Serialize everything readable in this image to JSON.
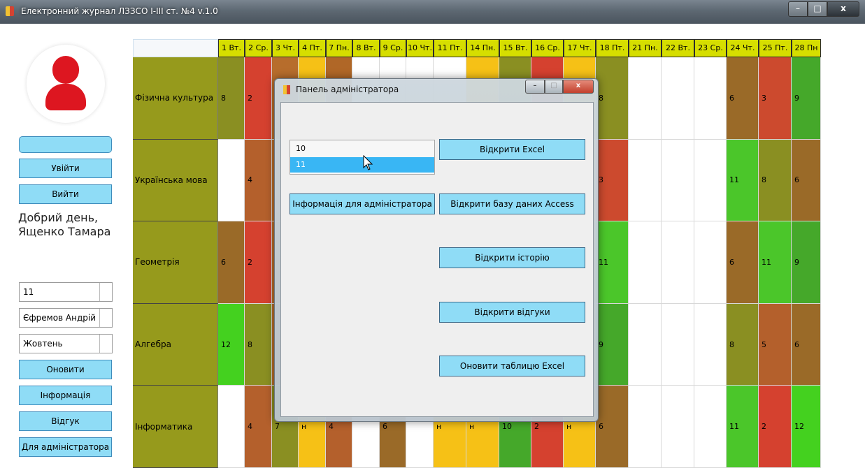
{
  "window": {
    "title": "Електронний журнал ЛЗЗСО І-ІІІ ст. №4 v.1.0",
    "controls": {
      "minimize": "–",
      "maximize": "□",
      "close": "x"
    }
  },
  "sidebar": {
    "name_field": "",
    "login_label": "Увійти",
    "logout_label": "Вийти",
    "greeting_line1": "Добрий день,",
    "greeting_line2": "Ященко Тамара",
    "class_value": "11",
    "student_value": "Єфремов Андрій",
    "month_value": "Жовтень",
    "refresh_label": "Оновити",
    "info_label": "Інформація",
    "feedback_label": "Відгук",
    "admin_label": "Для адміністратора"
  },
  "grid": {
    "dates": [
      "1 Вт.",
      "2 Ср.",
      "3 Чт.",
      "4 Пт.",
      "7 Пн.",
      "8 Вт.",
      "9 Ср.",
      "10 Чт.",
      "11 Пт.",
      "14 Пн.",
      "15 Вт.",
      "16 Ср.",
      "17 Чт.",
      "18 Пт.",
      "21 Пн.",
      "22 Вт.",
      "23 Ср.",
      "24 Чт.",
      "25 Пт.",
      "28 Пн"
    ],
    "rows": [
      {
        "subject": "Фізична культура",
        "cells": [
          {
            "v": "8",
            "c": "#8a8f22"
          },
          {
            "v": "2",
            "c": "#d5412f"
          },
          {
            "v": "",
            "c": "#b76d2c"
          },
          {
            "v": "",
            "c": "#f6c116"
          },
          {
            "v": "",
            "c": "#b06727"
          },
          {
            "v": "",
            "c": "#ffffff"
          },
          {
            "v": "",
            "c": "#ffffff"
          },
          {
            "v": "",
            "c": "#ffffff"
          },
          {
            "v": "",
            "c": "#ffffff"
          },
          {
            "v": "",
            "c": "#f6c116"
          },
          {
            "v": "",
            "c": "#8a8f22"
          },
          {
            "v": "",
            "c": "#d5412f"
          },
          {
            "v": "",
            "c": "#f6c116"
          },
          {
            "v": "8",
            "c": "#8a8f22"
          },
          {
            "v": "",
            "c": "#ffffff"
          },
          {
            "v": "",
            "c": "#ffffff"
          },
          {
            "v": "",
            "c": "#ffffff"
          },
          {
            "v": "6",
            "c": "#9a6a28"
          },
          {
            "v": "3",
            "c": "#cc4a2e"
          },
          {
            "v": "9",
            "c": "#45a82a"
          }
        ]
      },
      {
        "subject": "Українська мова",
        "cells": [
          {
            "v": "",
            "c": "#ffffff"
          },
          {
            "v": "4",
            "c": "#b4602c"
          },
          {
            "v": "",
            "c": "#b76d2c"
          },
          {
            "v": "",
            "c": "#f6c116"
          },
          {
            "v": "",
            "c": "#b06727"
          },
          {
            "v": "",
            "c": "#ffffff"
          },
          {
            "v": "",
            "c": "#ffffff"
          },
          {
            "v": "",
            "c": "#ffffff"
          },
          {
            "v": "",
            "c": "#ffffff"
          },
          {
            "v": "",
            "c": "#f6c116"
          },
          {
            "v": "",
            "c": "#8a8f22"
          },
          {
            "v": "",
            "c": "#d5412f"
          },
          {
            "v": "",
            "c": "#f6c116"
          },
          {
            "v": "3",
            "c": "#cc4a2e"
          },
          {
            "v": "",
            "c": "#ffffff"
          },
          {
            "v": "",
            "c": "#ffffff"
          },
          {
            "v": "",
            "c": "#ffffff"
          },
          {
            "v": "11",
            "c": "#4bc62a"
          },
          {
            "v": "8",
            "c": "#8a8f22"
          },
          {
            "v": "6",
            "c": "#9a6a28"
          }
        ]
      },
      {
        "subject": "Геометрія",
        "cells": [
          {
            "v": "6",
            "c": "#9a6a28"
          },
          {
            "v": "2",
            "c": "#d5412f"
          },
          {
            "v": "",
            "c": "#b76d2c"
          },
          {
            "v": "",
            "c": "#f6c116"
          },
          {
            "v": "",
            "c": "#b06727"
          },
          {
            "v": "",
            "c": "#ffffff"
          },
          {
            "v": "",
            "c": "#ffffff"
          },
          {
            "v": "",
            "c": "#ffffff"
          },
          {
            "v": "",
            "c": "#ffffff"
          },
          {
            "v": "",
            "c": "#f6c116"
          },
          {
            "v": "",
            "c": "#8a8f22"
          },
          {
            "v": "",
            "c": "#d5412f"
          },
          {
            "v": "",
            "c": "#f6c116"
          },
          {
            "v": "11",
            "c": "#4bc62a"
          },
          {
            "v": "",
            "c": "#ffffff"
          },
          {
            "v": "",
            "c": "#ffffff"
          },
          {
            "v": "",
            "c": "#ffffff"
          },
          {
            "v": "6",
            "c": "#9a6a28"
          },
          {
            "v": "11",
            "c": "#4bc62a"
          },
          {
            "v": "9",
            "c": "#45a82a"
          }
        ]
      },
      {
        "subject": "Алгебра",
        "cells": [
          {
            "v": "12",
            "c": "#44d11f"
          },
          {
            "v": "8",
            "c": "#8a8f22"
          },
          {
            "v": "",
            "c": "#b76d2c"
          },
          {
            "v": "",
            "c": "#f6c116"
          },
          {
            "v": "",
            "c": "#b06727"
          },
          {
            "v": "",
            "c": "#ffffff"
          },
          {
            "v": "",
            "c": "#ffffff"
          },
          {
            "v": "",
            "c": "#ffffff"
          },
          {
            "v": "",
            "c": "#ffffff"
          },
          {
            "v": "",
            "c": "#f6c116"
          },
          {
            "v": "",
            "c": "#8a8f22"
          },
          {
            "v": "",
            "c": "#d5412f"
          },
          {
            "v": "",
            "c": "#f6c116"
          },
          {
            "v": "9",
            "c": "#45a82a"
          },
          {
            "v": "",
            "c": "#ffffff"
          },
          {
            "v": "",
            "c": "#ffffff"
          },
          {
            "v": "",
            "c": "#ffffff"
          },
          {
            "v": "8",
            "c": "#8a8f22"
          },
          {
            "v": "5",
            "c": "#b4602c"
          },
          {
            "v": "6",
            "c": "#9a6a28"
          }
        ]
      },
      {
        "subject": "Інформатика",
        "cells": [
          {
            "v": "",
            "c": "#ffffff"
          },
          {
            "v": "4",
            "c": "#b4602c"
          },
          {
            "v": "7",
            "c": "#8a8f22"
          },
          {
            "v": "н",
            "c": "#f6c116"
          },
          {
            "v": "4",
            "c": "#b4602c"
          },
          {
            "v": "",
            "c": "#ffffff"
          },
          {
            "v": "6",
            "c": "#9a6a28"
          },
          {
            "v": "",
            "c": "#ffffff"
          },
          {
            "v": "н",
            "c": "#f6c116"
          },
          {
            "v": "н",
            "c": "#f6c116"
          },
          {
            "v": "10",
            "c": "#45a82a"
          },
          {
            "v": "2",
            "c": "#d5412f"
          },
          {
            "v": "н",
            "c": "#f6c116"
          },
          {
            "v": "6",
            "c": "#9a6a28"
          },
          {
            "v": "",
            "c": "#ffffff"
          },
          {
            "v": "",
            "c": "#ffffff"
          },
          {
            "v": "",
            "c": "#ffffff"
          },
          {
            "v": "11",
            "c": "#4bc62a"
          },
          {
            "v": "2",
            "c": "#d5412f"
          },
          {
            "v": "12",
            "c": "#44d11f"
          }
        ]
      }
    ]
  },
  "admin_dialog": {
    "title": "Панель адміністратора",
    "list_items": [
      "10",
      "11"
    ],
    "selected_item": "11",
    "info_button": "Інформація для адміністратора",
    "open_excel": "Відкрити Excel",
    "open_access": "Відкрити базу даних Access",
    "open_history": "Відкрити історію",
    "open_feedback": "Відкрити відгуки",
    "refresh_excel": "Оновити таблицю Excel"
  }
}
